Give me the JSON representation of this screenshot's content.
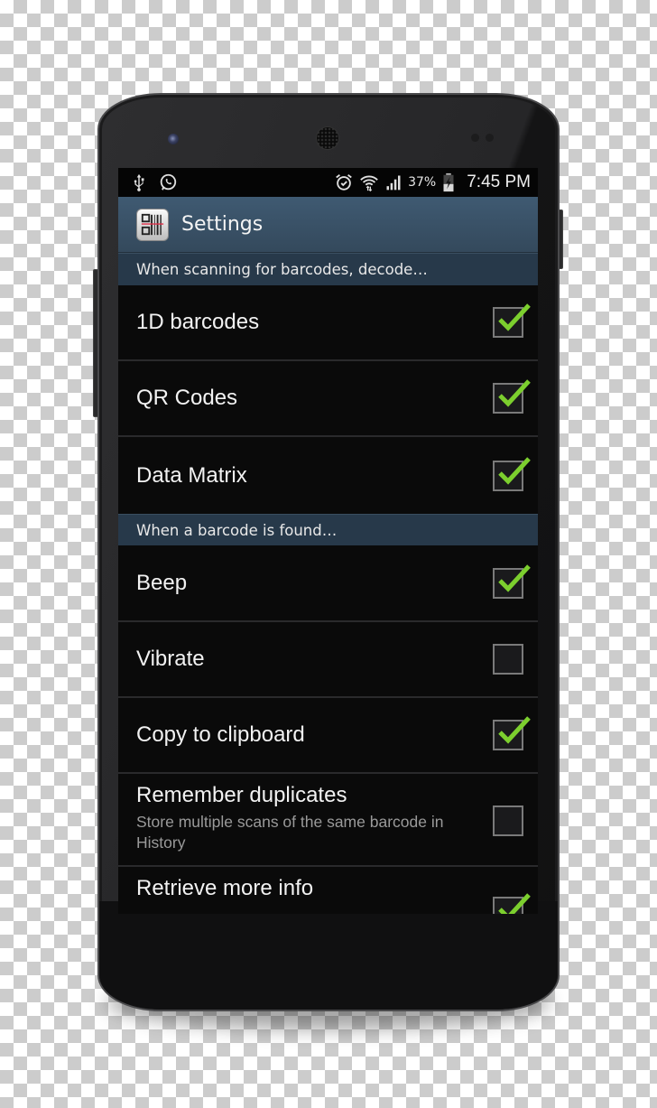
{
  "status_bar": {
    "left_icons": [
      "usb-icon",
      "whatsapp-icon"
    ],
    "right_icons": [
      "alarm-icon",
      "wifi-icon",
      "signal-icon"
    ],
    "battery_percent": "37%",
    "time": "7:45 PM"
  },
  "action_bar": {
    "app_icon": "barcode-scanner-icon",
    "title": "Settings"
  },
  "sections": [
    {
      "header": "When scanning for barcodes, decode…",
      "items": [
        {
          "title": "1D barcodes",
          "checked": true
        },
        {
          "title": "QR Codes",
          "checked": true
        },
        {
          "title": "Data Matrix",
          "checked": true
        }
      ]
    },
    {
      "header": "When a barcode is found…",
      "items": [
        {
          "title": "Beep",
          "checked": true
        },
        {
          "title": "Vibrate",
          "checked": false
        },
        {
          "title": "Copy to clipboard",
          "checked": true
        },
        {
          "title": "Remember duplicates",
          "summary": "Store multiple scans of the same barcode in History",
          "checked": false
        },
        {
          "title": "Retrieve more info",
          "checked": true
        }
      ]
    }
  ],
  "colors": {
    "action_bar": "#3f5a72",
    "section_header": "#27394a",
    "check_accent": "#7ccf2e",
    "background": "#0a0a0a"
  }
}
